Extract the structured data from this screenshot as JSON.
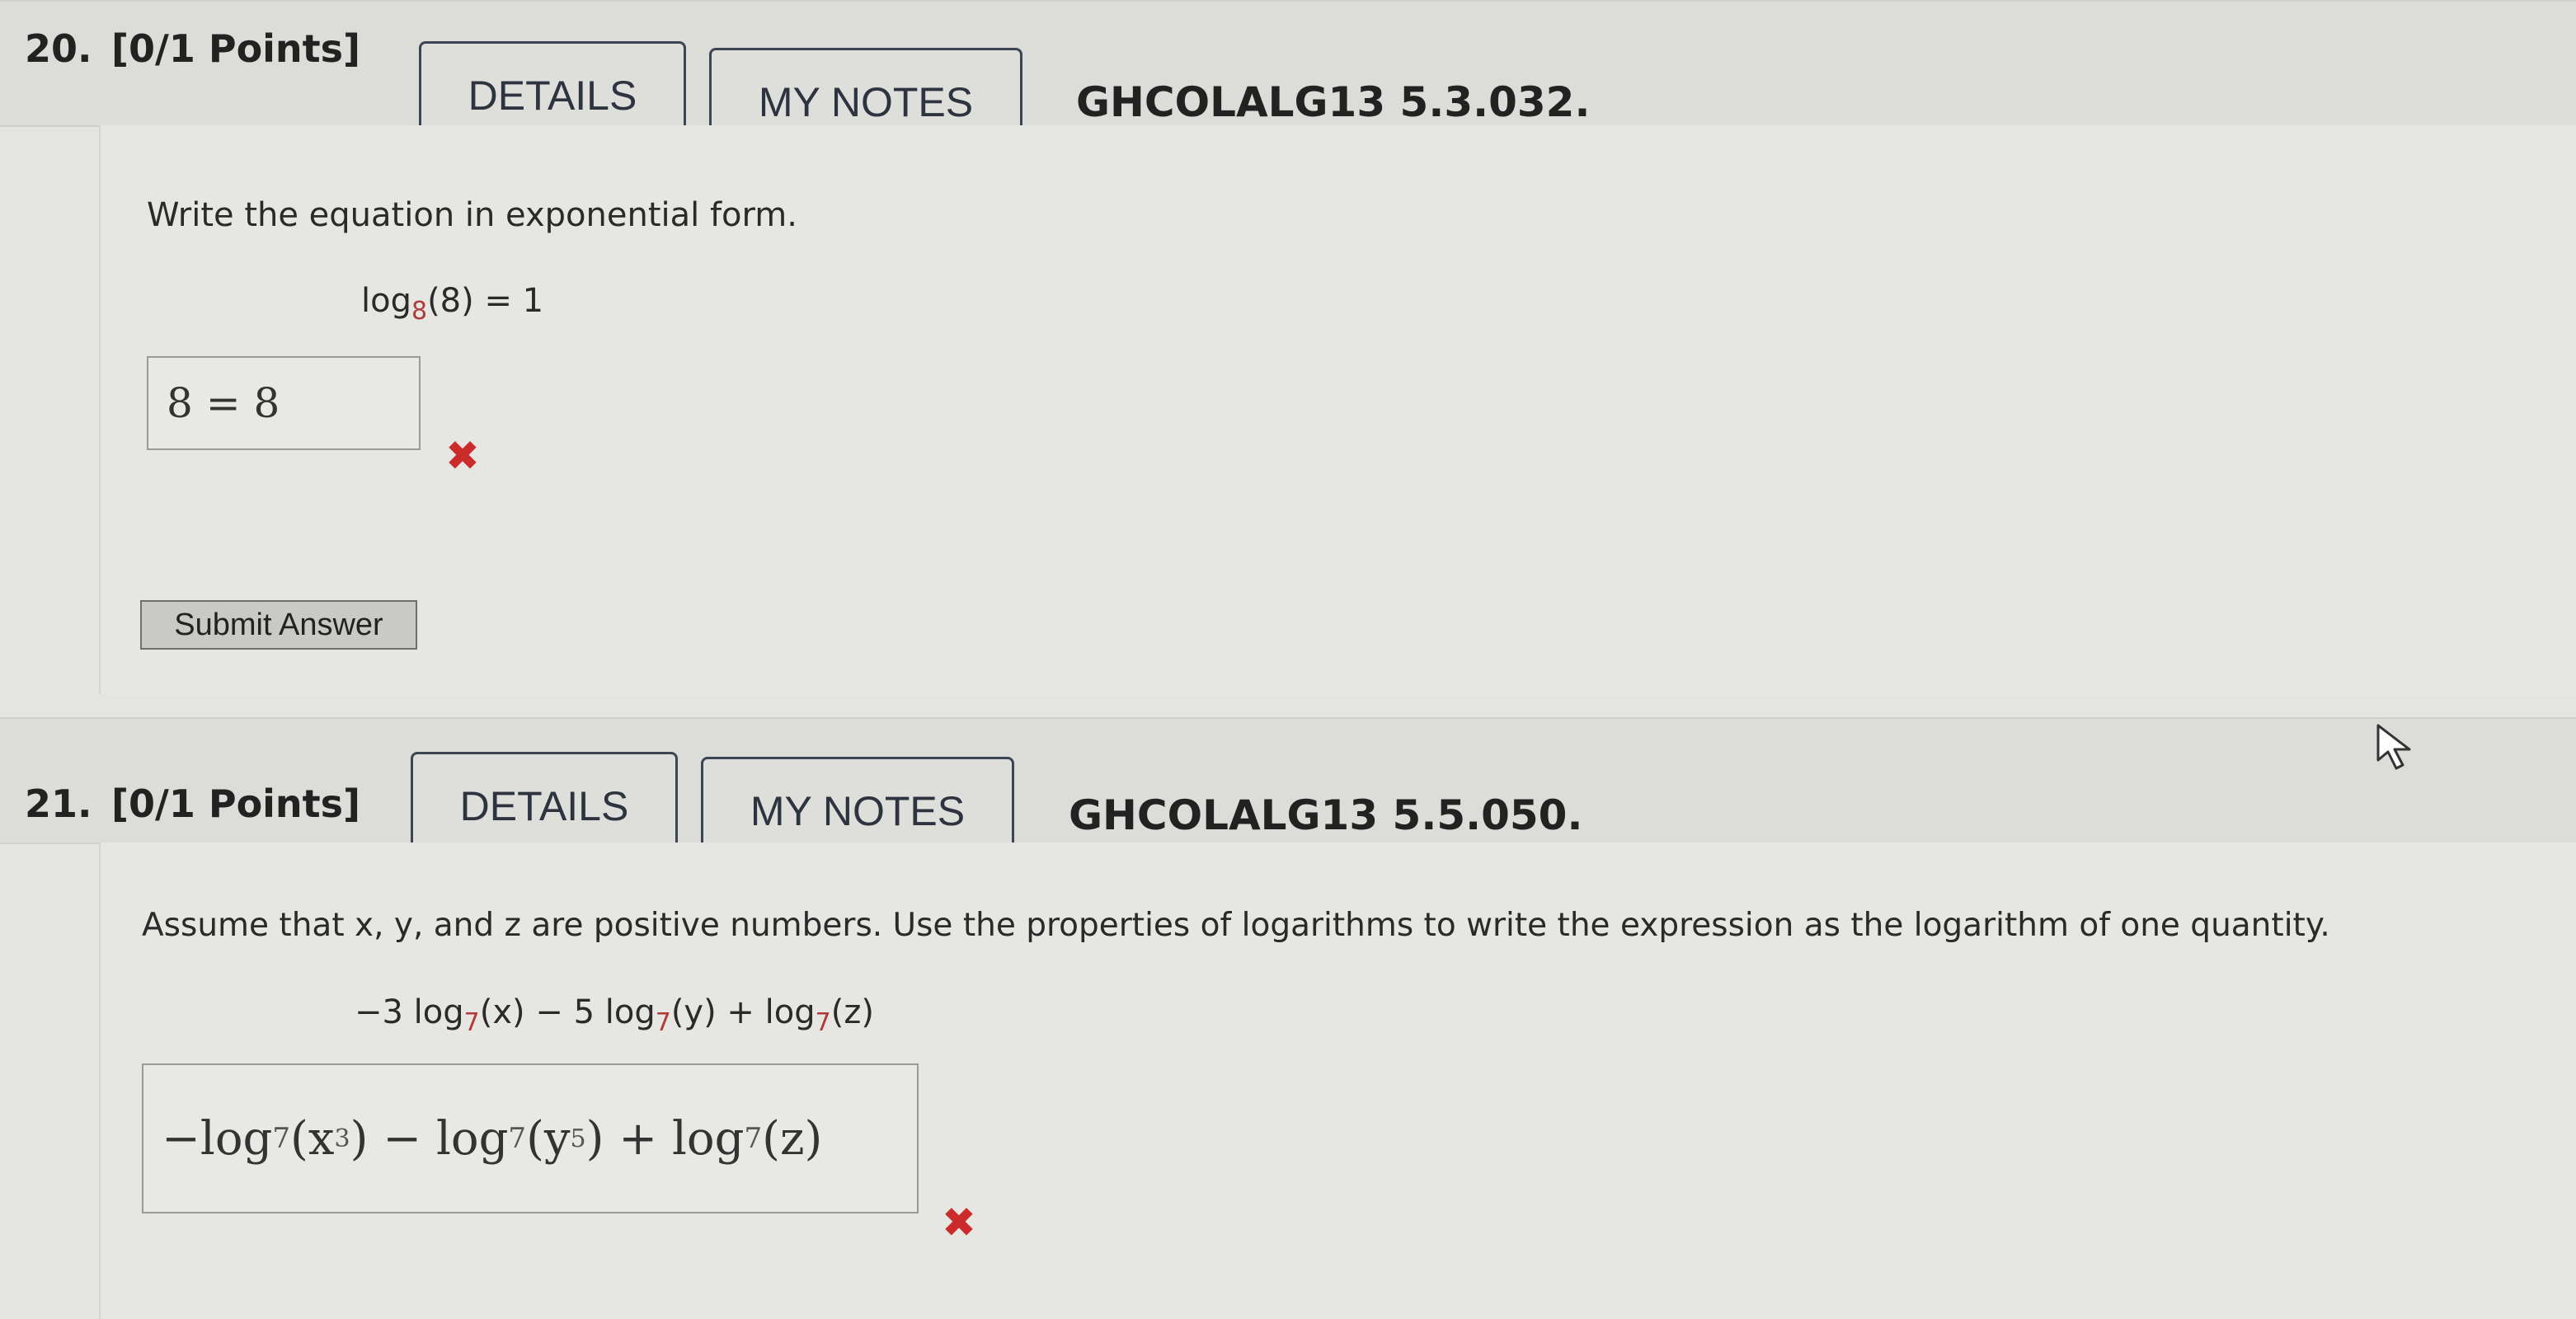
{
  "q20": {
    "number": "20.",
    "points": "[0/1 Points]",
    "details_label": "DETAILS",
    "notes_label": "MY NOTES",
    "code": "GHCOLALG13 5.3.032.",
    "prompt": "Write the equation in exponential form.",
    "equation": {
      "prefix": "log",
      "base": "8",
      "rest": "(8) = 1"
    },
    "answer": "8 = 8",
    "status": "incorrect",
    "submit_label": "Submit Answer"
  },
  "q21": {
    "number": "21.",
    "points": "[0/1 Points]",
    "details_label": "DETAILS",
    "notes_label": "MY NOTES",
    "code": "GHCOLALG13 5.5.050.",
    "prompt": "Assume that x, y, and z are positive numbers. Use the properties of logarithms to write the expression as the logarithm of one quantity.",
    "expression": {
      "t1": "−3 log",
      "b1": "7",
      "a1": "(x) − 5 log",
      "b2": "7",
      "a2": "(y) + log",
      "b3": "7",
      "a3": "(z)"
    },
    "answer": {
      "t1": "−log",
      "b1": "7",
      "a1": "(x",
      "e1": "3",
      "c1": ") − log",
      "b2": "7",
      "a2": "(y",
      "e2": "5",
      "c2": ") + log",
      "b3": "7",
      "a3": "(z)"
    },
    "status": "incorrect"
  },
  "colors": {
    "incorrect_mark": "#cc2b2b",
    "subscript": "#b03a3a",
    "button_border": "#3b4553"
  }
}
